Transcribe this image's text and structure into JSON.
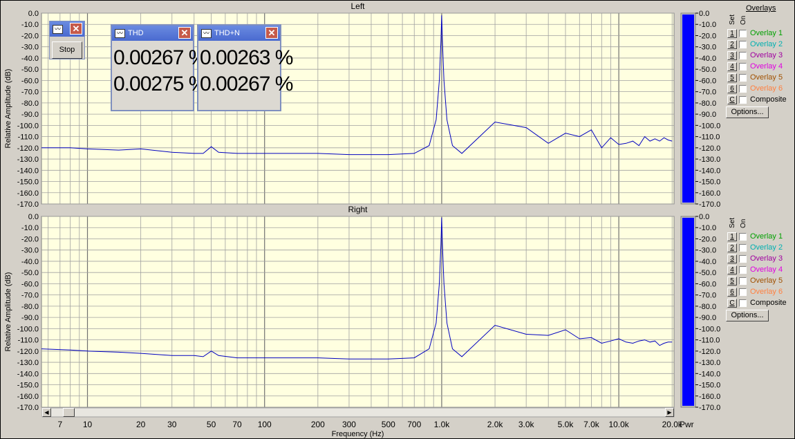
{
  "stop_button": "Stop",
  "meters": [
    {
      "title": "THD",
      "line1": "0.00267 %",
      "line2": "0.00275 %"
    },
    {
      "title": "THD+N",
      "line1": "0.00263 %",
      "line2": "0.00267 %"
    }
  ],
  "overlays_title": "Overlays",
  "set_label": "Set",
  "on_label": "On",
  "overlays": [
    {
      "key": "1",
      "label": "Overlay 1",
      "color": "#00a000"
    },
    {
      "key": "2",
      "label": "Overlay 2",
      "color": "#00b0b0"
    },
    {
      "key": "3",
      "label": "Overlay 3",
      "color": "#a000a0"
    },
    {
      "key": "4",
      "label": "Overlay 4",
      "color": "#e000e0"
    },
    {
      "key": "5",
      "label": "Overlay 5",
      "color": "#a05000"
    },
    {
      "key": "6",
      "label": "Overlay 6",
      "color": "#ff8040"
    },
    {
      "key": "C",
      "label": "Composite",
      "color": "#000000"
    }
  ],
  "options_button": "Options...",
  "freq_ticks": [
    "7",
    "10",
    "20",
    "30",
    "50",
    "70",
    "100",
    "200",
    "300",
    "500",
    "700",
    "1.0k",
    "2.0k",
    "3.0k",
    "5.0k",
    "7.0k",
    "10.0k",
    "20.0k"
  ],
  "pwr_label": "Pwr",
  "colors": {
    "plot_bg": "#ffffe0",
    "trace": "#0000c0",
    "meter_bar": "#0000ff"
  },
  "chart_data": [
    {
      "type": "line",
      "title": "Left",
      "xlabel": "Frequency (Hz)",
      "ylabel": "Relative Amplitude (dB)",
      "x_scale": "log",
      "xlim": [
        5.5,
        20500
      ],
      "ylim": [
        -170,
        0
      ],
      "yticks": [
        "0.0",
        "-10.0",
        "-20.0",
        "-30.0",
        "-40.0",
        "-50.0",
        "-60.0",
        "-70.0",
        "-80.0",
        "-90.0",
        "-100.0",
        "-110.0",
        "-120.0",
        "-130.0",
        "-140.0",
        "-150.0",
        "-160.0",
        "-170.0"
      ],
      "grid": true,
      "series": [
        {
          "x": [
            5.5,
            8,
            10,
            15,
            20,
            30,
            40,
            45,
            50,
            55,
            70,
            100,
            200,
            300,
            500,
            700,
            850,
            930,
            970,
            990,
            1000,
            1010,
            1030,
            1070,
            1150,
            1300,
            2000,
            3000,
            4000,
            5000,
            6000,
            7000,
            8000,
            9000,
            10000,
            11000,
            12000,
            13000,
            14000,
            15000,
            16000,
            17000,
            18000,
            19000,
            20000
          ],
          "y": [
            -120,
            -120,
            -121,
            -122,
            -121,
            -124,
            -125,
            -125,
            -119,
            -124,
            -125,
            -125,
            -125,
            -126,
            -126,
            -125,
            -118,
            -95,
            -60,
            -25,
            -2,
            -25,
            -60,
            -95,
            -118,
            -125,
            -97,
            -102,
            -116,
            -107,
            -110,
            -104,
            -120,
            -111,
            -117,
            -116,
            -114,
            -118,
            -110,
            -114,
            -112,
            -114,
            -111,
            -113,
            -114
          ]
        }
      ]
    },
    {
      "type": "line",
      "title": "Right",
      "xlabel": "Frequency (Hz)",
      "ylabel": "Relative Amplitude (dB)",
      "x_scale": "log",
      "xlim": [
        5.5,
        20500
      ],
      "ylim": [
        -170,
        0
      ],
      "yticks": [
        "0.0",
        "-10.0",
        "-20.0",
        "-30.0",
        "-40.0",
        "-50.0",
        "-60.0",
        "-70.0",
        "-80.0",
        "-90.0",
        "-100.0",
        "-110.0",
        "-120.0",
        "-130.0",
        "-140.0",
        "-150.0",
        "-160.0",
        "-170.0"
      ],
      "grid": true,
      "series": [
        {
          "x": [
            5.5,
            8,
            10,
            15,
            20,
            30,
            40,
            45,
            50,
            55,
            70,
            100,
            200,
            300,
            500,
            700,
            850,
            930,
            970,
            990,
            1000,
            1010,
            1030,
            1070,
            1150,
            1300,
            2000,
            3000,
            4000,
            5000,
            6000,
            7000,
            8000,
            9000,
            10000,
            11000,
            12000,
            13000,
            14000,
            15000,
            16000,
            17000,
            18000,
            19000,
            20000
          ],
          "y": [
            -118,
            -119,
            -120,
            -121,
            -122,
            -124,
            -124,
            -125,
            -120,
            -124,
            -126,
            -126,
            -126,
            -127,
            -127,
            -126,
            -118,
            -95,
            -60,
            -25,
            -1,
            -25,
            -60,
            -95,
            -118,
            -125,
            -97,
            -105,
            -106,
            -101,
            -109,
            -108,
            -113,
            -111,
            -109,
            -112,
            -113,
            -111,
            -110,
            -112,
            -111,
            -115,
            -113,
            -112,
            -112
          ]
        }
      ]
    }
  ]
}
